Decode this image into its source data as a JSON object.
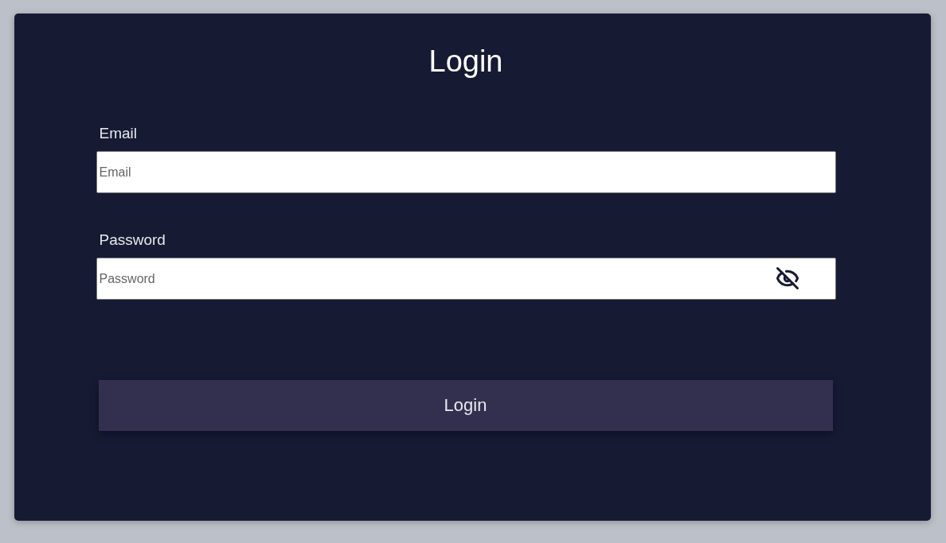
{
  "title": "Login",
  "fields": [
    {
      "label": "Email",
      "placeholder": "Email",
      "kind": "text"
    },
    {
      "label": "Password",
      "placeholder": "Password",
      "kind": "password",
      "revealed": false
    }
  ],
  "submit_button": "Login"
}
